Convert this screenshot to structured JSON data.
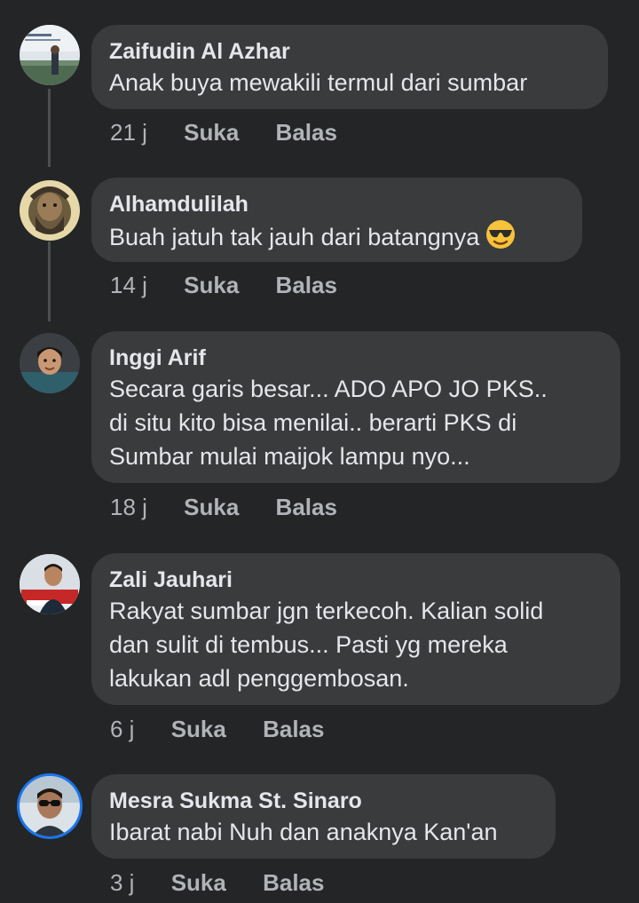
{
  "comments": [
    {
      "author": "Zaifudin Al Azhar",
      "lines": [
        "Anak buya mewakili termul dari  sumbar"
      ],
      "time": "21 j",
      "like_label": "Suka",
      "reply_label": "Balas"
    },
    {
      "author": "Alhamdulilah",
      "lines": [
        "Buah jatuh tak jauh dari batangnya"
      ],
      "emoji": "smiling-face-with-sunglasses",
      "time": "14 j",
      "like_label": "Suka",
      "reply_label": "Balas"
    },
    {
      "author": "Inggi Arif",
      "lines": [
        "Secara garis besar... ADO APO JO  PKS..",
        "di situ kito bisa menilai.. berarti PKS di",
        "Sumbar mulai maijok lampu nyo..."
      ],
      "time": "18 j",
      "like_label": "Suka",
      "reply_label": "Balas"
    },
    {
      "author": "Zali Jauhari",
      "lines": [
        "Rakyat sumbar jgn terkecoh. Kalian solid",
        "dan sulit di tembus... Pasti yg mereka",
        "lakukan adl penggembosan."
      ],
      "time": "6 j",
      "like_label": "Suka",
      "reply_label": "Balas"
    },
    {
      "author": "Mesra Sukma St. Sinaro",
      "lines": [
        "Ibarat nabi Nuh dan anaknya Kan'an"
      ],
      "time": "3 j",
      "like_label": "Suka",
      "reply_label": "Balas"
    }
  ],
  "colors": {
    "background": "#242526",
    "bubble": "#3a3b3c",
    "text": "#e4e6eb",
    "meta": "#b0b3b8",
    "thread_line": "#4e4f50",
    "avatar_ring": "#1877f2"
  }
}
